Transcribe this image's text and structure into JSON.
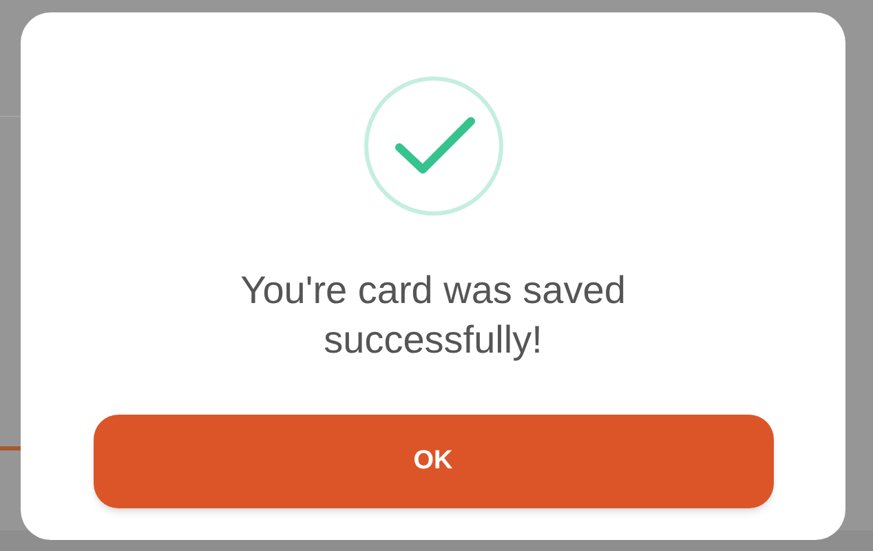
{
  "dialog": {
    "message": "You're card was saved successfully!",
    "button": "OK"
  }
}
